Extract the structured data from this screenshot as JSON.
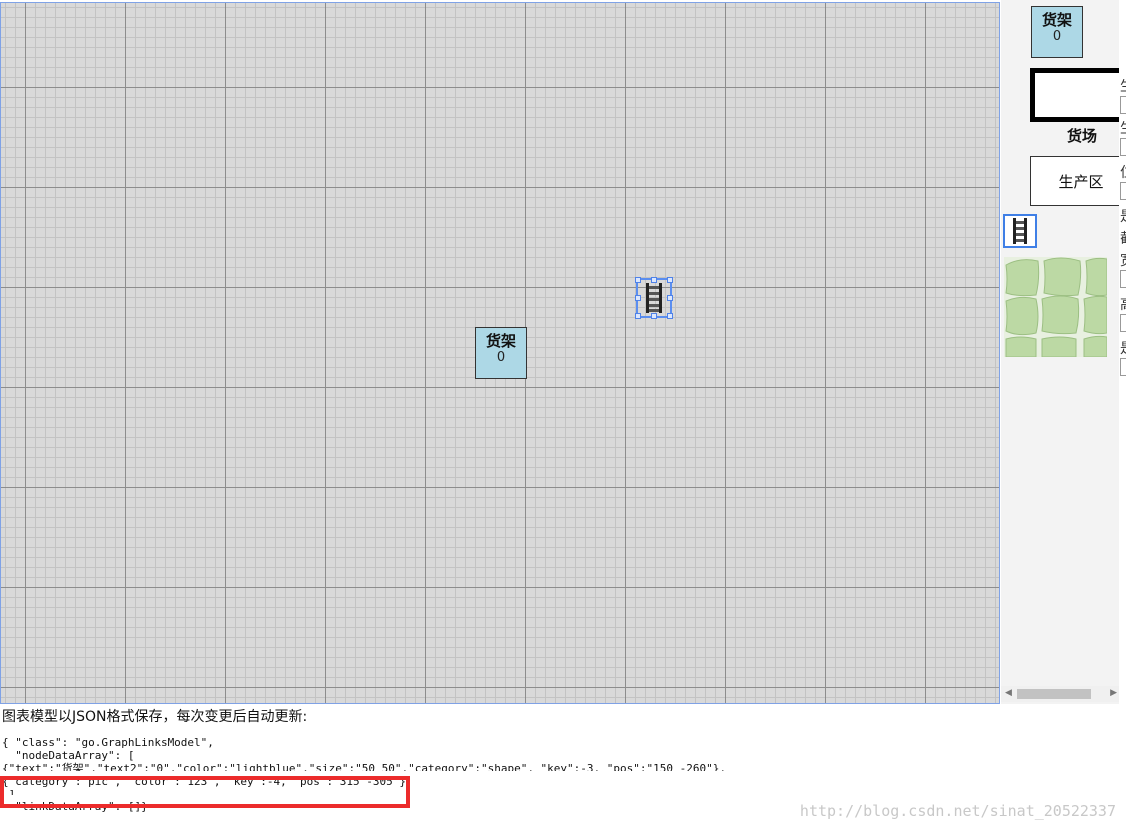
{
  "diagram": {
    "rack_node": {
      "title": "货架",
      "count": "0"
    }
  },
  "palette": {
    "rack": {
      "title": "货架",
      "count": "0"
    },
    "yard_label": "货场",
    "production_label": "生产区"
  },
  "properties_panel": {
    "clipped_labels": [
      "生",
      "生",
      "位",
      "是",
      "截",
      "宽",
      "高",
      "是"
    ]
  },
  "caption": "图表模型以JSON格式保存，每次变更后自动更新:",
  "json_text": {
    "line1": "{ \"class\": \"go.GraphLinksModel\",",
    "line2": "  \"nodeDataArray\": [",
    "line3": "{\"text\":\"货架\",\"text2\":\"0\",\"color\":\"lightblue\",\"size\":\"50 50\",\"category\":\"shape\", \"key\":-3, \"pos\":\"150 -260\"},",
    "line4": "{\"category\":\"pic\", \"color\":\"123\", \"key\":-4, \"pos\":\"315 -305\"}",
    "line5": " ]",
    "line6": "  \"linkDataArray\": []}"
  },
  "watermark": "http://blog.csdn.net/sinat_20522337",
  "colors": {
    "rack_fill": "#add8e6",
    "selection": "#5b8ef0",
    "highlight": "#ec2b2b",
    "grass": "#bcd9a4"
  }
}
